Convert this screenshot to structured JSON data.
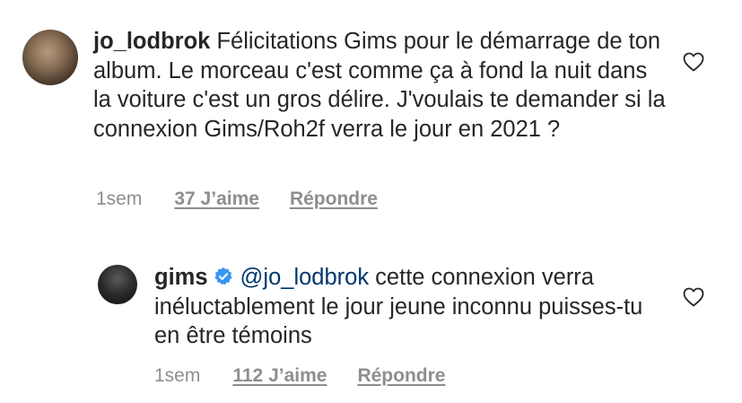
{
  "comments": [
    {
      "username": "jo_lodbrok",
      "text": "Félicitations Gims pour le démarrage de ton album. Le morceau c'est comme ça à fond la nuit dans la voiture c'est un gros délire. J'voulais te demander si la connexion Gims/Roh2f verra le jour en 2021 ?",
      "time": "1sem",
      "likes": "37 J’aime",
      "reply": "Répondre",
      "like_icon": "heart-icon"
    },
    {
      "username": "gims",
      "verified": true,
      "mention": "@jo_lodbrok",
      "text": " cette connexion verra inéluctablement le jour jeune inconnu puisses-tu en être témoins",
      "time": "1sem",
      "likes": "112 J’aime",
      "reply": "Répondre",
      "like_icon": "heart-icon"
    }
  ],
  "colors": {
    "text": "#262626",
    "meta": "#8e8e8e",
    "mention": "#00376b",
    "verified": "#3897f0"
  }
}
